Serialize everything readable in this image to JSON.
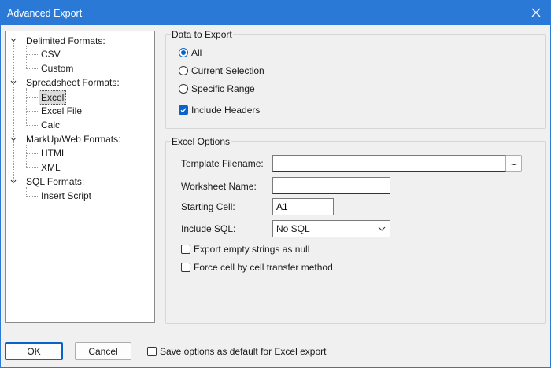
{
  "window": {
    "title": "Advanced Export"
  },
  "tree": {
    "groups": [
      {
        "label": "Delimited Formats:",
        "children": [
          "CSV",
          "Custom"
        ]
      },
      {
        "label": "Spreadsheet Formats:",
        "children": [
          "Excel",
          "Excel File",
          "Calc"
        ]
      },
      {
        "label": "MarkUp/Web Formats:",
        "children": [
          "HTML",
          "XML"
        ]
      },
      {
        "label": "SQL Formats:",
        "children": [
          "Insert Script"
        ]
      }
    ],
    "selected": "Excel"
  },
  "data_to_export": {
    "title": "Data to Export",
    "options": [
      "All",
      "Current Selection",
      "Specific Range"
    ],
    "selected": "All",
    "include_headers_label": "Include Headers",
    "include_headers_checked": true
  },
  "excel_options": {
    "title": "Excel Options",
    "template_label": "Template Filename:",
    "template_value": "",
    "browse_label": "...",
    "worksheet_label": "Worksheet Name:",
    "worksheet_value": "",
    "starting_cell_label": "Starting Cell:",
    "starting_cell_value": "A1",
    "include_sql_label": "Include SQL:",
    "include_sql_value": "No SQL",
    "empty_null_label": "Export empty strings as null",
    "empty_null_checked": false,
    "force_cell_label": "Force cell by cell transfer method",
    "force_cell_checked": false
  },
  "footer": {
    "ok_label": "OK",
    "cancel_label": "Cancel",
    "save_default_label": "Save options as default for Excel export",
    "save_default_checked": false
  },
  "colors": {
    "accent": "#2b79d6",
    "check": "#0a63c9"
  }
}
